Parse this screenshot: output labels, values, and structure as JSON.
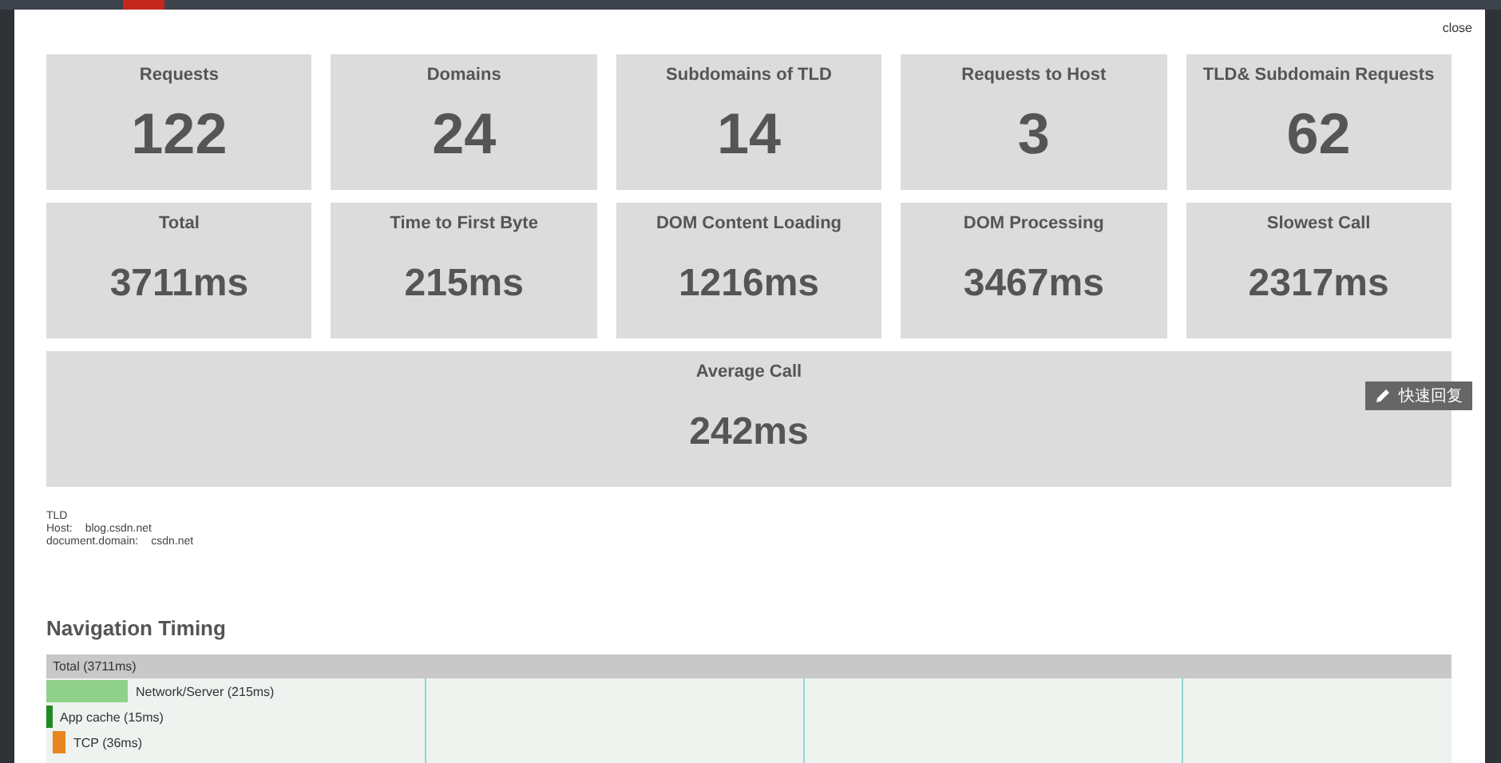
{
  "window": {
    "close_label": "close"
  },
  "stats": [
    {
      "label": "Requests",
      "value": "122",
      "kind": "count",
      "wide": false
    },
    {
      "label": "Domains",
      "value": "24",
      "kind": "count",
      "wide": false
    },
    {
      "label": "Subdomains of TLD",
      "value": "14",
      "kind": "count",
      "wide": false
    },
    {
      "label": "Requests to Host",
      "value": "3",
      "kind": "count",
      "wide": false
    },
    {
      "label": "TLD& Subdomain Requests",
      "value": "62",
      "kind": "count",
      "wide": false
    },
    {
      "label": "Total",
      "value": "3711ms",
      "kind": "timing",
      "wide": false
    },
    {
      "label": "Time to First Byte",
      "value": "215ms",
      "kind": "timing",
      "wide": false
    },
    {
      "label": "DOM Content Loading",
      "value": "1216ms",
      "kind": "timing",
      "wide": false
    },
    {
      "label": "DOM Processing",
      "value": "3467ms",
      "kind": "timing",
      "wide": false
    },
    {
      "label": "Slowest Call",
      "value": "2317ms",
      "kind": "timing",
      "wide": false
    },
    {
      "label": "Average Call",
      "value": "242ms",
      "kind": "timing",
      "wide": true
    }
  ],
  "host_info": {
    "heading": "TLD",
    "fields": [
      {
        "label": "Host:",
        "value": "blog.csdn.net"
      },
      {
        "label": "document.domain:",
        "value": "csdn.net"
      }
    ]
  },
  "navigation_timing": {
    "title": "Navigation Timing",
    "total_label": "Total (3711ms)",
    "bars": [
      {
        "label": "Network/Server (215ms)",
        "level": 0.058,
        "color": "#8fd18a"
      },
      {
        "label": "App cache (15ms)",
        "level": 0.004,
        "color": "#1f8a1f"
      },
      {
        "label": "TCP (36ms)",
        "level": 0.0097,
        "color": "#e8851e"
      }
    ]
  },
  "quick_reply_button": {
    "label": "快速回复"
  }
}
